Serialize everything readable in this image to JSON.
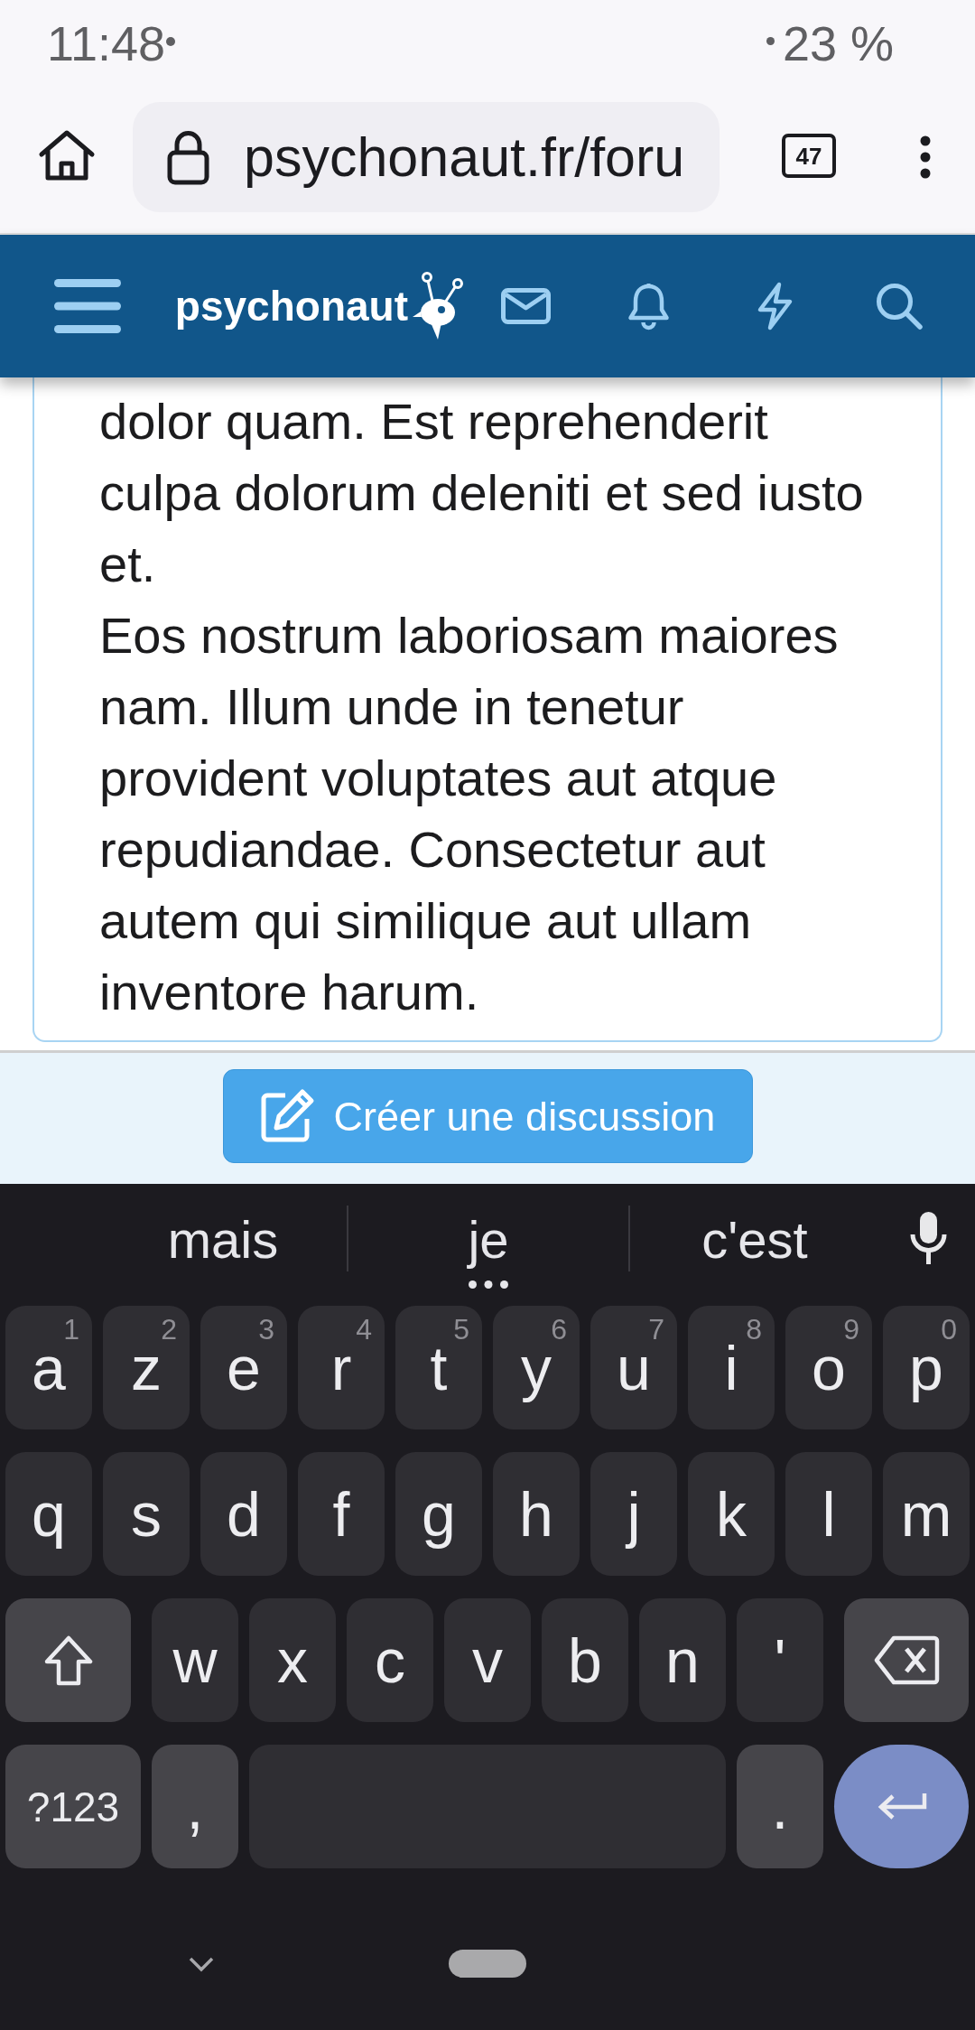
{
  "status_bar": {
    "time": "11:48",
    "battery": "23 %"
  },
  "browser": {
    "url": "psychonaut.fr/foru",
    "tab_count": "47"
  },
  "site_header": {
    "logo": "psychonaut"
  },
  "post": {
    "paragraphs": [
      "dolor quam. Est reprehenderit culpa dolorum deleniti et sed iusto et.",
      "Eos nostrum laboriosam maiores nam. Illum unde in tenetur provident voluptates aut atque repudiandae. Consectetur aut autem qui similique aut ullam inventore harum."
    ]
  },
  "footer": {
    "button": "Créer une discussion"
  },
  "keyboard": {
    "suggestions": [
      {
        "text": "mais",
        "more": false
      },
      {
        "text": "je",
        "more": true
      },
      {
        "text": "c'est",
        "more": false
      }
    ],
    "rows": [
      [
        {
          "kind": "letter",
          "label": "a",
          "hint": "1"
        },
        {
          "kind": "letter",
          "label": "z",
          "hint": "2"
        },
        {
          "kind": "letter",
          "label": "e",
          "hint": "3"
        },
        {
          "kind": "letter",
          "label": "r",
          "hint": "4"
        },
        {
          "kind": "letter",
          "label": "t",
          "hint": "5"
        },
        {
          "kind": "letter",
          "label": "y",
          "hint": "6"
        },
        {
          "kind": "letter",
          "label": "u",
          "hint": "7"
        },
        {
          "kind": "letter",
          "label": "i",
          "hint": "8"
        },
        {
          "kind": "letter",
          "label": "o",
          "hint": "9"
        },
        {
          "kind": "letter",
          "label": "p",
          "hint": "0"
        }
      ],
      [
        {
          "kind": "letter",
          "label": "q"
        },
        {
          "kind": "letter",
          "label": "s"
        },
        {
          "kind": "letter",
          "label": "d"
        },
        {
          "kind": "letter",
          "label": "f"
        },
        {
          "kind": "letter",
          "label": "g"
        },
        {
          "kind": "letter",
          "label": "h"
        },
        {
          "kind": "letter",
          "label": "j"
        },
        {
          "kind": "letter",
          "label": "k"
        },
        {
          "kind": "letter",
          "label": "l"
        },
        {
          "kind": "letter",
          "label": "m"
        }
      ],
      [
        {
          "kind": "shift"
        },
        {
          "kind": "letter",
          "label": "w"
        },
        {
          "kind": "letter",
          "label": "x"
        },
        {
          "kind": "letter",
          "label": "c"
        },
        {
          "kind": "letter",
          "label": "v"
        },
        {
          "kind": "letter",
          "label": "b"
        },
        {
          "kind": "letter",
          "label": "n"
        },
        {
          "kind": "letter",
          "label": "'"
        },
        {
          "kind": "backspace"
        }
      ],
      [
        {
          "kind": "symbols",
          "label": "?123"
        },
        {
          "kind": "punct",
          "label": ","
        },
        {
          "kind": "space"
        },
        {
          "kind": "punct",
          "label": "."
        },
        {
          "kind": "enter"
        }
      ]
    ]
  }
}
